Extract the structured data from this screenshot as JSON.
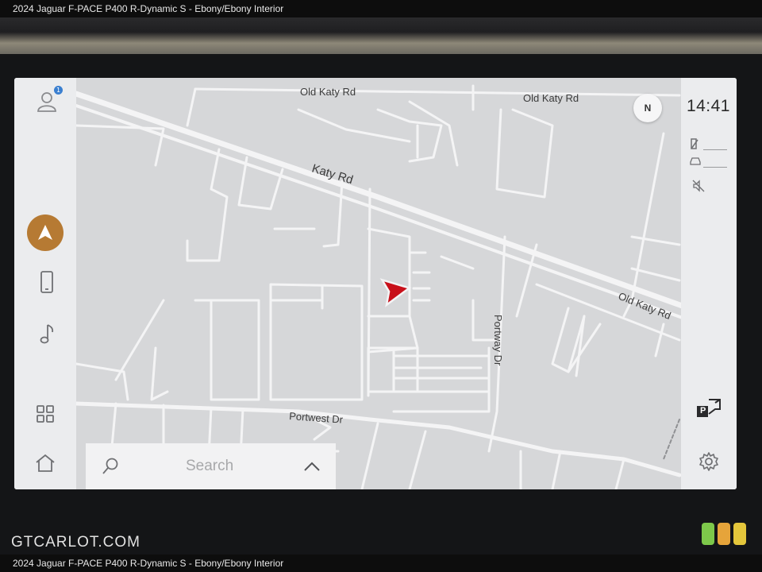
{
  "caption": "2024 Jaguar F-PACE P400 R-Dynamic S - Ebony/Ebony Interior",
  "watermark": "GTCARLOT.COM",
  "screen": {
    "clock": "14:41",
    "compass": "N",
    "profile_badge": "1",
    "search": {
      "placeholder": "Search"
    },
    "left_rail": {
      "icons": [
        "profile-icon",
        "navigation-icon",
        "phone-icon",
        "media-icon",
        "apps-grid-icon",
        "home-icon"
      ]
    },
    "right_rail": {
      "icons": [
        "signal-icon",
        "vehicle-icon",
        "mute-icon",
        "park-assist-icon",
        "settings-icon"
      ],
      "park_label": "P"
    },
    "map": {
      "labels": {
        "old_katy_left": "Old Katy Rd",
        "old_katy_right": "Old Katy Rd",
        "katy_rd": "Katy Rd",
        "old_katy_diag": "Old Katy Rd",
        "portway": "Portway Dr",
        "portwest": "Portwest Dr"
      }
    }
  },
  "colors": {
    "nav_accent": "#b67a33",
    "position_arrow": "#c8101a",
    "map_background": "#d6d7d9",
    "road": "#f4f4f5",
    "light_green": "#7dc84a",
    "light_amber": "#e6a43a",
    "light_yellow": "#e4c63b"
  }
}
